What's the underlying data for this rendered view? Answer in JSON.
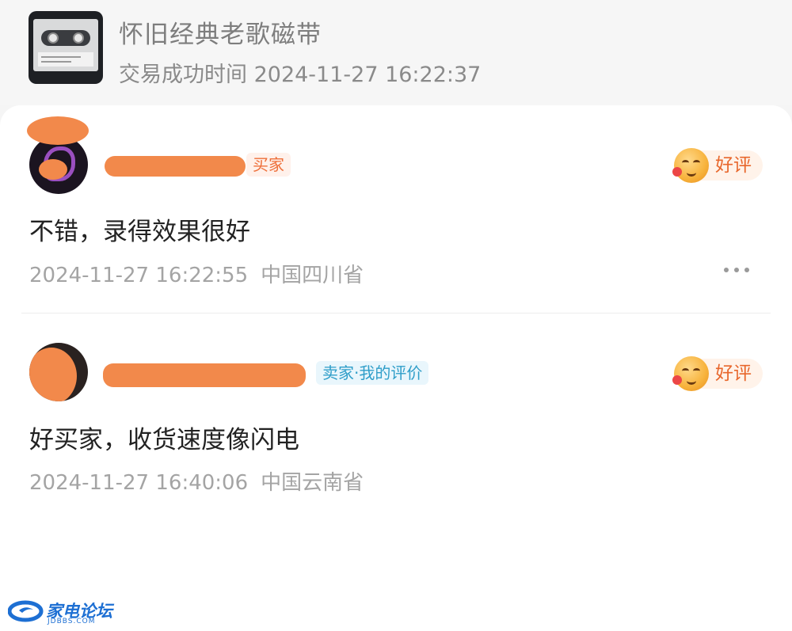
{
  "product": {
    "title": "怀旧经典老歌磁带",
    "trade_time": "交易成功时间 2024-11-27 16:22:37"
  },
  "reviews": [
    {
      "role_tag": "买家",
      "rating": "好评",
      "comment": "不错，录得效果很好",
      "time": "2024-11-27 16:22:55",
      "location": "中国四川省"
    },
    {
      "role_tag": "卖家·我的评价",
      "rating": "好评",
      "comment": "好买家，收货速度像闪电",
      "time": "2024-11-27 16:40:06",
      "location": "中国云南省"
    }
  ],
  "watermark": {
    "brand": "家电论坛",
    "site": "JDBBS.COM"
  },
  "colors": {
    "redaction": "#f2894b",
    "buyer_tag": "#ee6f3a",
    "seller_tag": "#2f9ec9",
    "rating_text": "#e8672c"
  },
  "icons": {
    "rating": "smiley-face-icon",
    "more": "more-dots-icon"
  }
}
